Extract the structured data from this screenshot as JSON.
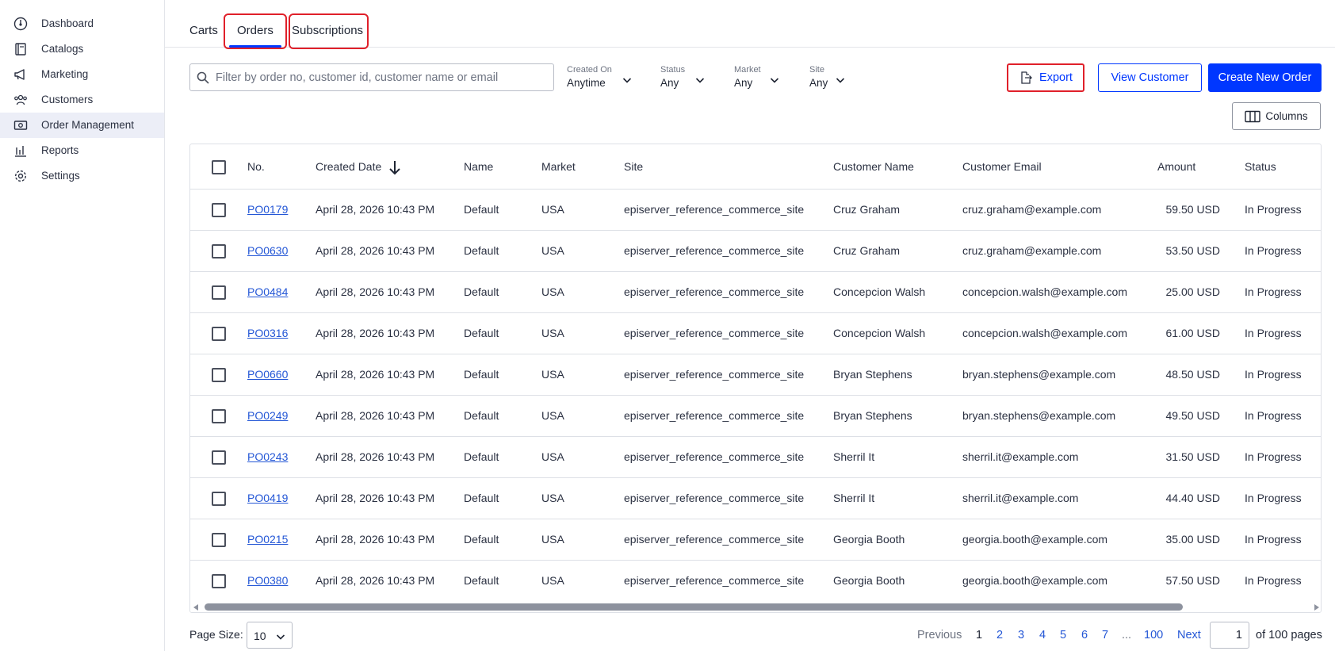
{
  "sidebar": {
    "items": [
      {
        "label": "Dashboard",
        "icon": "dashboard-icon"
      },
      {
        "label": "Catalogs",
        "icon": "catalog-icon"
      },
      {
        "label": "Marketing",
        "icon": "megaphone-icon"
      },
      {
        "label": "Customers",
        "icon": "customers-icon"
      },
      {
        "label": "Order Management",
        "icon": "order-management-icon",
        "active": true
      },
      {
        "label": "Reports",
        "icon": "reports-icon"
      },
      {
        "label": "Settings",
        "icon": "gear-icon"
      }
    ]
  },
  "tabs": [
    {
      "label": "Carts"
    },
    {
      "label": "Orders",
      "active": true
    },
    {
      "label": "Subscriptions"
    }
  ],
  "filters": {
    "search_placeholder": "Filter by order no, customer id, customer name or email",
    "dropdowns": [
      {
        "label": "Created On",
        "value": "Anytime"
      },
      {
        "label": "Status",
        "value": "Any"
      },
      {
        "label": "Market",
        "value": "Any"
      },
      {
        "label": "Site",
        "value": "Any"
      }
    ]
  },
  "actions": {
    "export": "Export",
    "view_customer": "View Customer",
    "create_order": "Create New Order",
    "columns": "Columns"
  },
  "table": {
    "headers": [
      "No.",
      "Created Date",
      "Name",
      "Market",
      "Site",
      "Customer Name",
      "Customer Email",
      "Amount",
      "Status"
    ],
    "rows": [
      {
        "no": "PO0179",
        "date": "April 28, 2026 10:43 PM",
        "name": "Default",
        "market": "USA",
        "site": "episerver_reference_commerce_site",
        "customer": "Cruz Graham",
        "email": "cruz.graham@example.com",
        "amount": "59.50 USD",
        "status": "In Progress"
      },
      {
        "no": "PO0630",
        "date": "April 28, 2026 10:43 PM",
        "name": "Default",
        "market": "USA",
        "site": "episerver_reference_commerce_site",
        "customer": "Cruz Graham",
        "email": "cruz.graham@example.com",
        "amount": "53.50 USD",
        "status": "In Progress"
      },
      {
        "no": "PO0484",
        "date": "April 28, 2026 10:43 PM",
        "name": "Default",
        "market": "USA",
        "site": "episerver_reference_commerce_site",
        "customer": "Concepcion Walsh",
        "email": "concepcion.walsh@example.com",
        "amount": "25.00 USD",
        "status": "In Progress"
      },
      {
        "no": "PO0316",
        "date": "April 28, 2026 10:43 PM",
        "name": "Default",
        "market": "USA",
        "site": "episerver_reference_commerce_site",
        "customer": "Concepcion Walsh",
        "email": "concepcion.walsh@example.com",
        "amount": "61.00 USD",
        "status": "In Progress"
      },
      {
        "no": "PO0660",
        "date": "April 28, 2026 10:43 PM",
        "name": "Default",
        "market": "USA",
        "site": "episerver_reference_commerce_site",
        "customer": "Bryan Stephens",
        "email": "bryan.stephens@example.com",
        "amount": "48.50 USD",
        "status": "In Progress"
      },
      {
        "no": "PO0249",
        "date": "April 28, 2026 10:43 PM",
        "name": "Default",
        "market": "USA",
        "site": "episerver_reference_commerce_site",
        "customer": "Bryan Stephens",
        "email": "bryan.stephens@example.com",
        "amount": "49.50 USD",
        "status": "In Progress"
      },
      {
        "no": "PO0243",
        "date": "April 28, 2026 10:43 PM",
        "name": "Default",
        "market": "USA",
        "site": "episerver_reference_commerce_site",
        "customer": "Sherril It",
        "email": "sherril.it@example.com",
        "amount": "31.50 USD",
        "status": "In Progress"
      },
      {
        "no": "PO0419",
        "date": "April 28, 2026 10:43 PM",
        "name": "Default",
        "market": "USA",
        "site": "episerver_reference_commerce_site",
        "customer": "Sherril It",
        "email": "sherril.it@example.com",
        "amount": "44.40 USD",
        "status": "In Progress"
      },
      {
        "no": "PO0215",
        "date": "April 28, 2026 10:43 PM",
        "name": "Default",
        "market": "USA",
        "site": "episerver_reference_commerce_site",
        "customer": "Georgia Booth",
        "email": "georgia.booth@example.com",
        "amount": "35.00 USD",
        "status": "In Progress"
      },
      {
        "no": "PO0380",
        "date": "April 28, 2026 10:43 PM",
        "name": "Default",
        "market": "USA",
        "site": "episerver_reference_commerce_site",
        "customer": "Georgia Booth",
        "email": "georgia.booth@example.com",
        "amount": "57.50 USD",
        "status": "In Progress"
      }
    ]
  },
  "pagination": {
    "page_size_label": "Page Size:",
    "page_size": "10",
    "previous": "Previous",
    "pages": [
      "1",
      "2",
      "3",
      "4",
      "5",
      "6",
      "7"
    ],
    "ellipsis": "...",
    "last_page": "100",
    "next": "Next",
    "current_page": "1",
    "of_pages": "of 100 pages"
  },
  "colors": {
    "accent": "#0037ff",
    "highlight": "#e0202a",
    "link": "#2457d6"
  }
}
